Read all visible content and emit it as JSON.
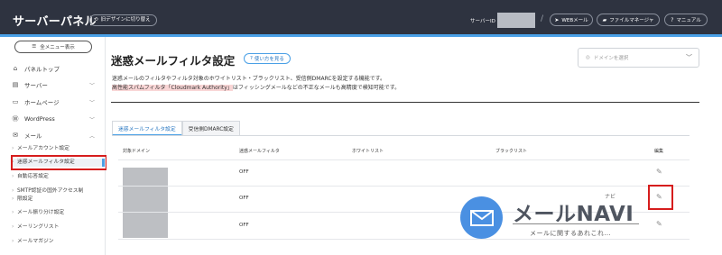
{
  "header": {
    "brand": "サーバーパネル",
    "design_toggle": "旧デザインに切り替え",
    "server_id_label": "サーバーID",
    "separator": "/",
    "buttons": [
      {
        "label": "WEBメール",
        "icon": "paper-plane-icon"
      },
      {
        "label": "ファイルマネージャ",
        "icon": "folder-icon"
      },
      {
        "label": "マニュアル",
        "icon": "question-circle-icon"
      }
    ],
    "colors": {
      "bar": "#2e3340",
      "accent": "#4aa0e6"
    }
  },
  "sidebar": {
    "menu_button": "全メニュー表示",
    "items": [
      {
        "label": "パネルトップ",
        "icon": "home-icon"
      },
      {
        "label": "サーバー",
        "icon": "server-icon"
      },
      {
        "label": "ホームページ",
        "icon": "window-icon"
      },
      {
        "label": "WordPress",
        "icon": "wordpress-icon"
      },
      {
        "label": "メール",
        "icon": "mail-icon"
      }
    ],
    "sub_items": [
      "メールアカウント設定",
      "迷惑メールフィルタ設定",
      "自動応答設定",
      "SMTP認証の国外アクセス制",
      "限設定",
      "メール振り分け設定",
      "メーリングリスト",
      "メールマガジン"
    ]
  },
  "main": {
    "title": "迷惑メールフィルタ設定",
    "help_label": "使い方を見る",
    "domain_placeholder": "ドメインを選択",
    "description_line1": "迷惑メールのフィルタやフィルタ対象のホワイトリスト・ブラックリスト、受信側DMARCを設定する機能です。",
    "description_line2_highlight": "高性能スパムフィルタ「Cloudmark Authority」",
    "description_line2_rest": "はフィッシングメールなどの不正なメールも高精度で検知可能です。",
    "tabs": [
      "迷惑メールフィルタ設定",
      "受信側DMARC設定"
    ],
    "table": {
      "headers": [
        "対象ドメイン",
        "迷惑メールフィルタ",
        "ホワイトリスト",
        "ブラックリスト",
        "編集"
      ],
      "rows": [
        {
          "filter": "OFF"
        },
        {
          "filter": "OFF"
        },
        {
          "filter": "OFF"
        }
      ]
    }
  },
  "watermark": {
    "title": "メールNAVI",
    "ruby": "ナビ",
    "tagline": "メールに関するあれこれ…",
    "color": "#4a90e2"
  }
}
